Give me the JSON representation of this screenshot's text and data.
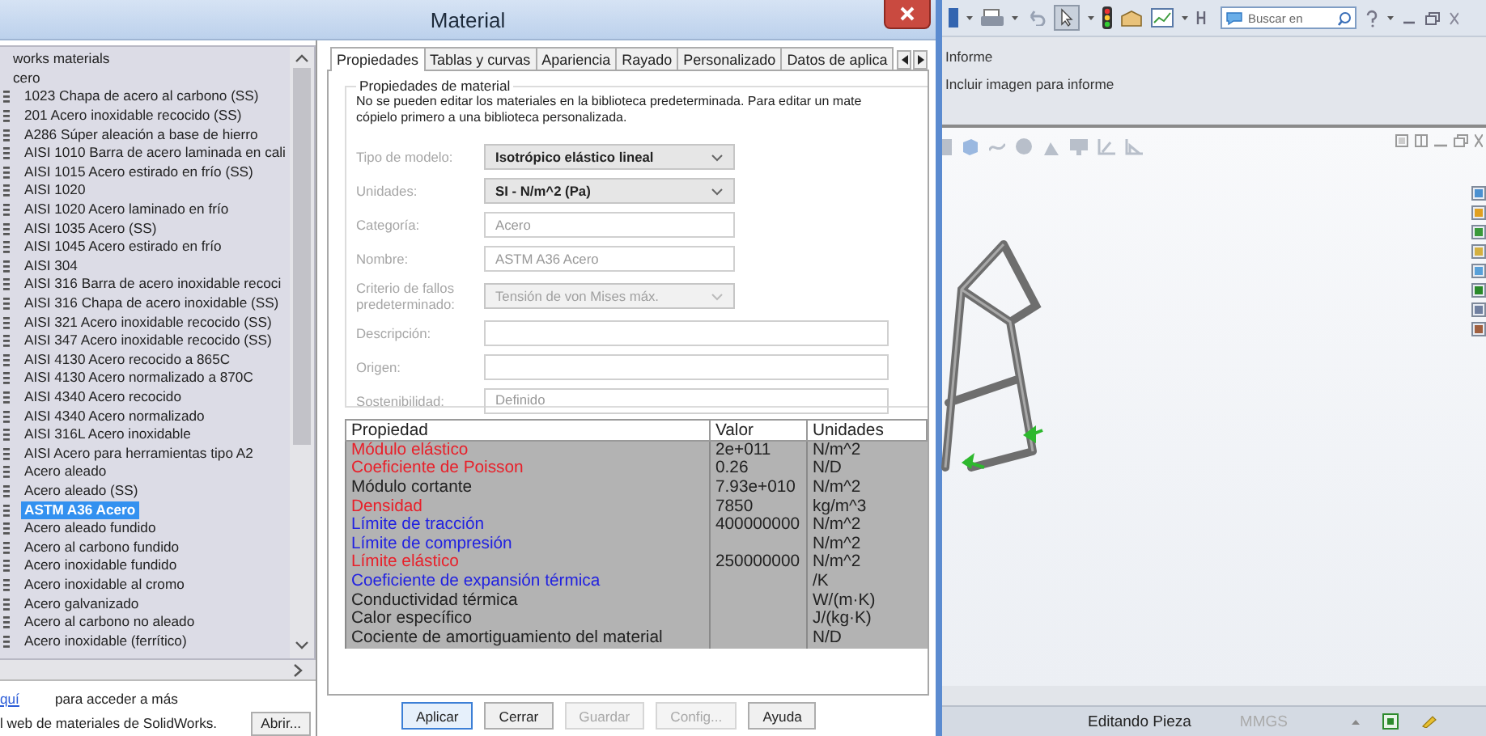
{
  "dialog": {
    "title": "Material"
  },
  "library": {
    "tree": [
      {
        "label": "works materials",
        "selected": false,
        "children": [
          {
            "label": "cero",
            "selected": false,
            "children": [
              {
                "label": "1023 Chapa de acero al carbono (SS)",
                "selected": false
              },
              {
                "label": "201 Acero inoxidable recocido (SS)",
                "selected": false
              },
              {
                "label": "A286 Súper aleación a base de hierro",
                "selected": false
              },
              {
                "label": "AISI 1010 Barra de acero laminada en cali",
                "selected": false
              },
              {
                "label": "AISI 1015 Acero estirado en frío (SS)",
                "selected": false
              },
              {
                "label": "AISI 1020",
                "selected": false
              },
              {
                "label": "AISI 1020 Acero laminado en frío",
                "selected": false
              },
              {
                "label": "AISI 1035 Acero (SS)",
                "selected": false
              },
              {
                "label": "AISI 1045 Acero estirado en frío",
                "selected": false
              },
              {
                "label": "AISI 304",
                "selected": false
              },
              {
                "label": "AISI 316 Barra de acero inoxidable recoci",
                "selected": false
              },
              {
                "label": "AISI 316 Chapa de acero inoxidable (SS)",
                "selected": false
              },
              {
                "label": "AISI 321 Acero inoxidable recocido (SS)",
                "selected": false
              },
              {
                "label": "AISI 347 Acero inoxidable recocido (SS)",
                "selected": false
              },
              {
                "label": "AISI 4130 Acero recocido a 865C",
                "selected": false
              },
              {
                "label": "AISI 4130 Acero normalizado a 870C",
                "selected": false
              },
              {
                "label": "AISI 4340 Acero recocido",
                "selected": false
              },
              {
                "label": "AISI 4340 Acero normalizado",
                "selected": false
              },
              {
                "label": "AISI 316L Acero inoxidable",
                "selected": false
              },
              {
                "label": "AISI Acero para herramientas tipo A2",
                "selected": false
              },
              {
                "label": "Acero aleado",
                "selected": false
              },
              {
                "label": "Acero aleado (SS)",
                "selected": false
              },
              {
                "label": "ASTM A36 Acero",
                "selected": true
              },
              {
                "label": "Acero aleado fundido",
                "selected": false
              },
              {
                "label": "Acero al carbono fundido",
                "selected": false
              },
              {
                "label": "Acero inoxidable fundido",
                "selected": false
              },
              {
                "label": "Acero inoxidable al cromo",
                "selected": false
              },
              {
                "label": "Acero galvanizado",
                "selected": false
              },
              {
                "label": "Acero al carbono no aleado",
                "selected": false
              },
              {
                "label": "Acero inoxidable (ferrítico)",
                "selected": false
              }
            ]
          }
        ]
      }
    ],
    "link": "quí",
    "note": "para acceder a más",
    "note_2": "l web de materiales de SolidWorks.",
    "open_button": "Abrir..."
  },
  "tabs": [
    {
      "label": "Propiedades",
      "selected": true
    },
    {
      "label": "Tablas y curvas",
      "selected": false
    },
    {
      "label": "Apariencia",
      "selected": false
    },
    {
      "label": "Rayado",
      "selected": false
    },
    {
      "label": "Personalizado",
      "selected": false
    },
    {
      "label": "Datos de aplica",
      "selected": false
    }
  ],
  "properties": {
    "group_title": "Propiedades de material",
    "notice": [
      "No se pueden editar los materiales en la biblioteca predeterminada. Para editar un mate",
      "cópielo primero a una biblioteca personalizada."
    ],
    "fields": [
      {
        "label": "Tipo de modelo:",
        "kind": "dropdown",
        "value": "Isotrópico elástico lineal",
        "disabled": false
      },
      {
        "label": "Unidades:",
        "kind": "dropdown",
        "value": "SI - N/m^2 (Pa)",
        "disabled": false
      },
      {
        "label": "Categoría:",
        "kind": "text",
        "value": "Acero"
      },
      {
        "label": "Nombre:",
        "kind": "text",
        "value": "ASTM A36 Acero"
      },
      {
        "label": "Criterio de fallos predeterminado:",
        "kind": "dropdown",
        "value": "Tensión de von Mises máx.",
        "disabled": true
      },
      {
        "label": "Descripción:",
        "kind": "wide"
      },
      {
        "label": "Origen:",
        "kind": "wide"
      },
      {
        "label": "Sostenibilidad:",
        "kind": "wide",
        "value": "Definido"
      }
    ]
  },
  "table": {
    "columns": [
      "Propiedad",
      "Valor",
      "Unidades"
    ],
    "rows": [
      {
        "property": "Módulo elástico",
        "value": "2e+011",
        "units": "N/m^2",
        "color": "#e8202a"
      },
      {
        "property": "Coeficiente de Poisson",
        "value": "0.26",
        "units": "N/D",
        "color": "#e8202a"
      },
      {
        "property": "Módulo cortante",
        "value": "7.93e+010",
        "units": "N/m^2",
        "color": "#222222"
      },
      {
        "property": "Densidad",
        "value": "7850",
        "units": "kg/m^3",
        "color": "#e8202a"
      },
      {
        "property": "Límite de tracción",
        "value": "400000000",
        "units": "N/m^2",
        "color": "#2222e0"
      },
      {
        "property": "Límite de compresión",
        "units": "N/m^2",
        "color": "#2222e0"
      },
      {
        "property": "Límite elástico",
        "value": "250000000",
        "units": "N/m^2",
        "color": "#e8202a"
      },
      {
        "property": "Coeficiente de expansión térmica",
        "units": "/K",
        "color": "#2222e0"
      },
      {
        "property": "Conductividad térmica",
        "units": "W/(m·K)",
        "color": "#222222"
      },
      {
        "property": "Calor específico",
        "units": "J/(kg·K)",
        "color": "#222222"
      },
      {
        "property": "Cociente de amortiguamiento del material",
        "units": "N/D",
        "color": "#222222"
      }
    ]
  },
  "buttons": [
    {
      "label": "Aplicar",
      "disabled": false,
      "focused": true
    },
    {
      "label": "Cerrar",
      "disabled": false,
      "focused": false
    },
    {
      "label": "Guardar",
      "disabled": true,
      "focused": false
    },
    {
      "label": "Config...",
      "disabled": true,
      "focused": false
    },
    {
      "label": "Ayuda",
      "disabled": false,
      "focused": false
    }
  ],
  "app": {
    "search": {
      "placeholder": "Buscar en"
    },
    "report": {
      "title": "Informe",
      "option": "Incluir imagen para informe"
    },
    "status_bar": {
      "mode": "Editando Pieza",
      "units": "MMGS"
    }
  }
}
